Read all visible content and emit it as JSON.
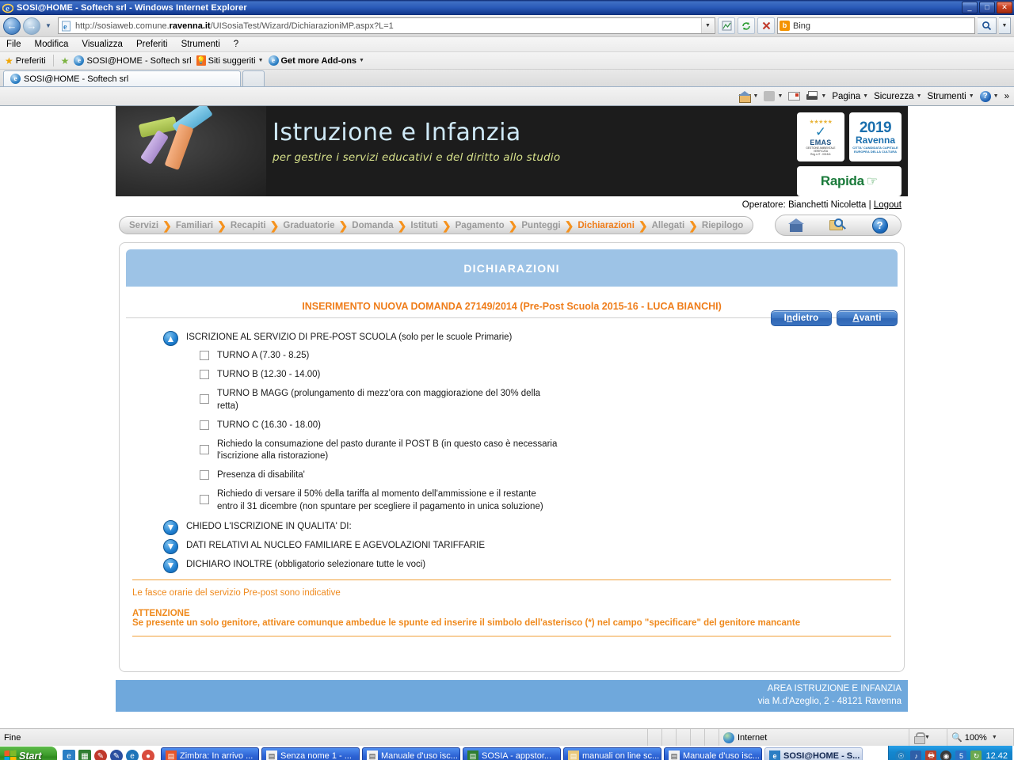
{
  "browser": {
    "window_title": "SOSI@HOME - Softech srl - Windows Internet Explorer",
    "window_buttons": {
      "minimize": "_",
      "maximize": "□",
      "close": "✕"
    },
    "url": "http://sosiaweb.comune.ravenna.it/UISosiaTest/Wizard/DichiarazioniMP.aspx?L=1",
    "url_bold": "ravenna.it",
    "url_prefix": "http://sosiaweb.comune.",
    "url_suffix": "/UISosiaTest/Wizard/DichiarazioniMP.aspx?L=1",
    "search_engine": "Bing",
    "menu": [
      "File",
      "Modifica",
      "Visualizza",
      "Preferiti",
      "Strumenti",
      "?"
    ],
    "favorites_label": "Preferiti",
    "favorites_items": [
      "SOSI@HOME - Softech srl",
      "Siti suggeriti",
      "Get more Add-ons"
    ],
    "tab_title": "SOSI@HOME - Softech srl",
    "command_bar": [
      "Pagina",
      "Sicurezza",
      "Strumenti"
    ],
    "command_overflow": "»",
    "status_text": "Fine",
    "status_zone": "Internet",
    "status_zoom": "100%"
  },
  "site": {
    "header_title": "Istruzione e Infanzia",
    "header_subtitle": "per gestire i servizi educativi e del diritto allo studio",
    "logos": {
      "emas_name": "EMAS",
      "emas_caption": "GESTIONE AMBIENTALE VERIFICATA",
      "emas_reg": "Reg.n.IT - 001341",
      "ravenna_year": "2019",
      "ravenna_city": "Ravenna",
      "ravenna_caption": "CITTA' CANDIDATA CAPITALE EUROPEA DELLA CULTURA",
      "rapida_name": "Rapida"
    },
    "operator_prefix": "Operatore:",
    "operator_name": "Bianchetti Nicoletta",
    "operator_separator": "|",
    "logout_label": "Logout",
    "footer_line1": "AREA ISTRUZIONE E INFANZIA",
    "footer_line2": "via M.d'Azeglio, 2 - 48121 Ravenna"
  },
  "breadcrumb": {
    "items": [
      {
        "label": "Servizi",
        "active": false
      },
      {
        "label": "Familiari",
        "active": false
      },
      {
        "label": "Recapiti",
        "active": false
      },
      {
        "label": "Graduatorie",
        "active": false
      },
      {
        "label": "Domanda",
        "active": false
      },
      {
        "label": "Istituti",
        "active": false
      },
      {
        "label": "Pagamento",
        "active": false
      },
      {
        "label": "Punteggi",
        "active": false
      },
      {
        "label": "Dichiarazioni",
        "active": true
      },
      {
        "label": "Allegati",
        "active": false
      },
      {
        "label": "Riepilogo",
        "active": false
      }
    ],
    "separator": "❯",
    "active_color": "#ef7d1a",
    "inactive_color": "#9a9a9a"
  },
  "page": {
    "panel_title": "DICHIARAZIONI",
    "subheading": "INSERIMENTO NUOVA DOMANDA 27149/2014 (Pre-Post Scuola 2015-16 - LUCA BIANCHI)",
    "back_button": {
      "pre": "I",
      "accel": "n",
      "post": "dietro",
      "full": "Indietro"
    },
    "next_button": {
      "pre": "",
      "accel": "A",
      "post": "vanti",
      "full": "Avanti"
    },
    "sections": [
      {
        "label": "ISCRIZIONE AL SERVIZIO DI PRE-POST SCUOLA (solo per le scuole Primarie)",
        "state": "expanded",
        "icon": "arrow-up-icon",
        "checkboxes": [
          {
            "label": "TURNO A (7.30 - 8.25)",
            "checked": false
          },
          {
            "label": "TURNO B (12.30 - 14.00)",
            "checked": false
          },
          {
            "label": "TURNO B MAGG (prolungamento di mezz'ora con maggiorazione del 30% della retta)",
            "checked": false
          },
          {
            "label": "TURNO C (16.30 - 18.00)",
            "checked": false
          },
          {
            "label": "Richiedo la consumazione del pasto durante il POST B (in questo caso è necessaria l'iscrizione alla ristorazione)",
            "checked": false
          },
          {
            "label": "Presenza di disabilita'",
            "checked": false
          },
          {
            "label": "Richiedo di versare il 50% della tariffa al momento dell'ammissione e il restante entro il 31 dicembre (non spuntare per scegliere il pagamento in unica soluzione)",
            "checked": false
          }
        ]
      },
      {
        "label": "CHIEDO L'ISCRIZIONE IN QUALITA' DI:",
        "state": "collapsed",
        "icon": "arrow-down-icon",
        "checkboxes": []
      },
      {
        "label": "DATI RELATIVI AL NUCLEO FAMILIARE E AGEVOLAZIONI TARIFFARIE",
        "state": "collapsed",
        "icon": "arrow-down-icon",
        "checkboxes": []
      },
      {
        "label": "DICHIARO INOLTRE (obbligatorio selezionare tutte le voci)",
        "state": "collapsed",
        "icon": "arrow-down-icon",
        "checkboxes": []
      }
    ],
    "notes": {
      "line1": "Le fasce orarie del servizio Pre-post sono indicative",
      "attention_title": "ATTENZIONE",
      "attention_text": "Se presente un solo genitore, attivare comunque ambedue le spunte ed inserire il simbolo dell'asterisco (*) nel campo \"specificare\" del genitore mancante"
    }
  },
  "taskbar": {
    "start_label": "Start",
    "buttons": [
      {
        "label": "Zimbra: In arrivo ...",
        "active": false
      },
      {
        "label": "Senza nome 1 - ...",
        "active": false
      },
      {
        "label": "Manuale d'uso isc...",
        "active": false
      },
      {
        "label": "SOSIA - appstor...",
        "active": false
      },
      {
        "label": "manuali on line sc...",
        "active": false
      },
      {
        "label": "Manuale d'uso isc...",
        "active": false
      },
      {
        "label": "SOSI@HOME - S...",
        "active": true
      }
    ],
    "clock": "12.42"
  }
}
